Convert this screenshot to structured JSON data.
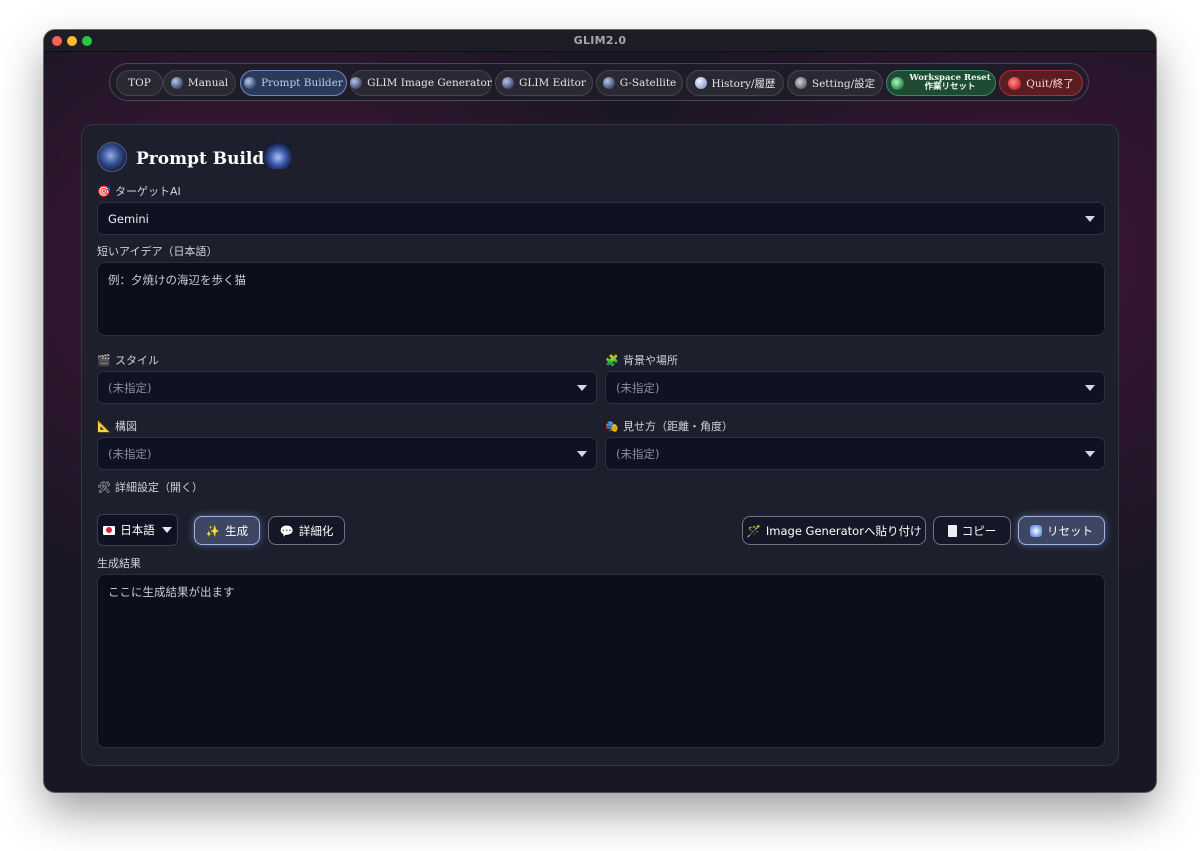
{
  "window": {
    "title": "GLIM2.0"
  },
  "nav": {
    "items": [
      {
        "label": "TOP",
        "icon": ""
      },
      {
        "label": "Manual",
        "icon": "manual-icon"
      },
      {
        "label": "Prompt Builder",
        "icon": "prompt-builder-icon"
      },
      {
        "label": "GLIM Image Generator",
        "icon": "image-generator-icon"
      },
      {
        "label": "GLIM Editor",
        "icon": "editor-icon"
      },
      {
        "label": "G-Satellite",
        "icon": "satellite-icon"
      },
      {
        "label": "History/履歴",
        "icon": "history-icon"
      },
      {
        "label": "Setting/設定",
        "icon": "gear-icon"
      },
      {
        "label_line1": "Workspace Reset",
        "label_line2": "作業リセット",
        "icon": "workspace-reset-icon"
      },
      {
        "label": "Quit/終了",
        "icon": "quit-icon"
      }
    ],
    "active_index": 2
  },
  "panel": {
    "title": "Prompt Builder",
    "target_ai": {
      "label": "ターゲットAI",
      "value": "Gemini",
      "emoji": "🎯"
    },
    "idea": {
      "label": "短いアイデア（日本語）",
      "placeholder": "例：夕焼けの海辺を歩く猫"
    },
    "style": {
      "label": "スタイル",
      "value": "(未指定)",
      "emoji": "🎬"
    },
    "background": {
      "label": "背景や場所",
      "value": "(未指定)",
      "emoji": "🧩"
    },
    "composition": {
      "label": "構図",
      "value": "(未指定)",
      "emoji": "📐"
    },
    "view": {
      "label": "見せ方（距離・角度）",
      "value": "(未指定)",
      "emoji": "🎭"
    },
    "details": {
      "label": "詳細設定（開く）",
      "emoji": "🛠"
    },
    "buttons": {
      "language": "日本語",
      "generate": "生成",
      "generate_emoji": "✨",
      "detail": "詳細化",
      "detail_emoji": "💬",
      "paste": "Image Generatorへ貼り付け",
      "paste_emoji": "🪄",
      "copy": "コピー",
      "reset": "リセット"
    },
    "result": {
      "label": "生成結果",
      "placeholder": "ここに生成結果が出ます"
    }
  }
}
